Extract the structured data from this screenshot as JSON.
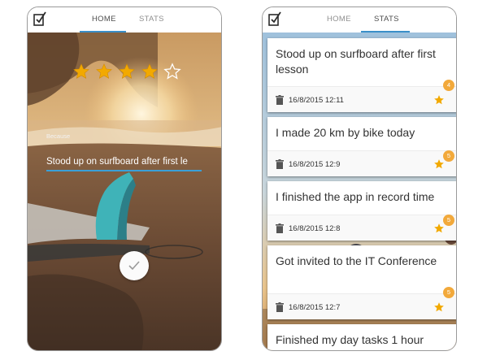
{
  "left_phone": {
    "tabs": [
      {
        "label": "HOME",
        "active": true
      },
      {
        "label": "STATS",
        "active": false
      }
    ],
    "rating": {
      "value": 4,
      "max": 5
    },
    "because_label": "Because",
    "reason_value": "Stood up on surfboard after first le",
    "colors": {
      "accent": "#3a8fc8",
      "star": "#f2a900"
    }
  },
  "right_phone": {
    "tabs": [
      {
        "label": "HOME",
        "active": false
      },
      {
        "label": "STATS",
        "active": true
      }
    ],
    "cards": [
      {
        "title": "Stood up on surfboard after first lesson",
        "date": "16/8/2015 12:11",
        "badge": "4"
      },
      {
        "title": "I made 20 km by bike today",
        "date": "16/8/2015 12:9",
        "badge": "5"
      },
      {
        "title": "I finished the app in record time",
        "date": "16/8/2015 12:8",
        "badge": "5"
      },
      {
        "title": "Got invited to the IT Conference",
        "date": "16/8/2015 12:7",
        "badge": "5"
      },
      {
        "title": "Finished my day tasks 1 hour"
      }
    ],
    "colors": {
      "badge": "#f2a93b",
      "star": "#f2a900"
    }
  }
}
